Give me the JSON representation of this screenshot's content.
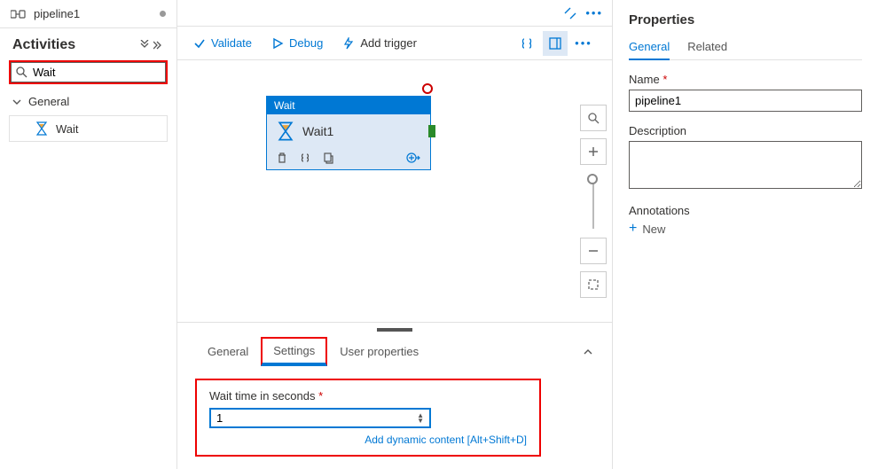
{
  "sidebar": {
    "pipeline_name": "pipeline1",
    "activities_title": "Activities",
    "search_value": "Wait",
    "group_label": "General",
    "activity_label": "Wait"
  },
  "toolbar": {
    "validate": "Validate",
    "debug": "Debug",
    "add_trigger": "Add trigger"
  },
  "node": {
    "type": "Wait",
    "name": "Wait1"
  },
  "bottom": {
    "tabs": {
      "general": "General",
      "settings": "Settings",
      "user_props": "User properties"
    },
    "wait_label": "Wait time in seconds",
    "wait_value": "1",
    "dyn_link": "Add dynamic content [Alt+Shift+D]"
  },
  "props": {
    "title": "Properties",
    "tabs": {
      "general": "General",
      "related": "Related"
    },
    "name_label": "Name",
    "name_value": "pipeline1",
    "desc_label": "Description",
    "desc_value": "",
    "ann_label": "Annotations",
    "new_label": "New"
  }
}
